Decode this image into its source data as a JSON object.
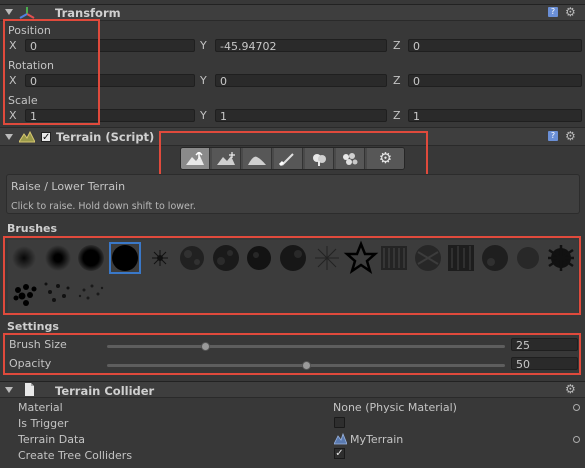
{
  "transform": {
    "title": "Transform",
    "position_label": "Position",
    "rotation_label": "Rotation",
    "scale_label": "Scale",
    "axis_x": "X",
    "axis_y": "Y",
    "axis_z": "Z",
    "position": {
      "x": "0",
      "y": "-45.94702",
      "z": "0"
    },
    "rotation": {
      "x": "0",
      "y": "0",
      "z": "0"
    },
    "scale": {
      "x": "1",
      "y": "1",
      "z": "1"
    }
  },
  "terrain": {
    "title": "Terrain (Script)",
    "enabled": true,
    "tools": [
      "raise-lower-terrain-icon",
      "paint-height-icon",
      "smooth-height-icon",
      "paint-texture-icon",
      "place-trees-icon",
      "paint-details-icon",
      "terrain-settings-icon"
    ],
    "tool_title": "Raise / Lower Terrain",
    "tool_hint": "Click to raise. Hold down shift to lower.",
    "brushes_label": "Brushes",
    "settings_label": "Settings",
    "brush_size_label": "Brush Size",
    "brush_size_value": "25",
    "opacity_label": "Opacity",
    "opacity_value": "50",
    "brush_size_level": 0.25,
    "opacity_level": 0.5
  },
  "collider": {
    "title": "Terrain Collider",
    "material_label": "Material",
    "material_value": "None (Physic Material)",
    "is_trigger_label": "Is Trigger",
    "terrain_data_label": "Terrain Data",
    "terrain_data_value": "MyTerrain",
    "create_tree_colliders_label": "Create Tree Colliders"
  },
  "colors": {
    "highlight": "#e04a3c",
    "panel": "#383838",
    "selected_brush": "#3a78c8"
  }
}
